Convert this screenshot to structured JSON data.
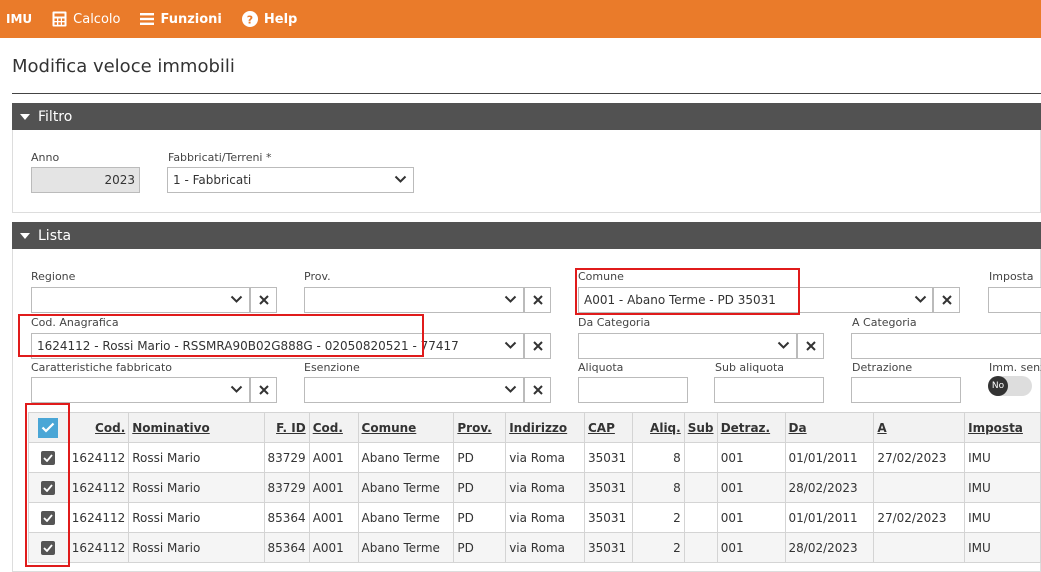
{
  "topbar": {
    "app": "IMU",
    "calcolo": "Calcolo",
    "funzioni": "Funzioni",
    "help": "Help"
  },
  "page_title": "Modifica veloce immobili",
  "filtro": {
    "title": "Filtro",
    "anno_label": "Anno",
    "anno_value": "2023",
    "fabbricati_label": "Fabbricati/Terreni *",
    "fabbricati_value": "1 - Fabbricati"
  },
  "lista": {
    "title": "Lista",
    "regione_label": "Regione",
    "regione_value": "",
    "prov_label": "Prov.",
    "prov_value": "",
    "comune_label": "Comune",
    "comune_value": "A001 - Abano Terme - PD 35031",
    "imposta_label": "Imposta",
    "cod_anagrafica_label": "Cod. Anagrafica",
    "cod_anagrafica_value": "1624112 - Rossi Mario - RSSMRA90B02G888G - 02050820521 - 77417",
    "da_categoria_label": "Da Categoria",
    "a_categoria_label": "A Categoria",
    "caratteristiche_label": "Caratteristiche fabbricato",
    "esenzione_label": "Esenzione",
    "aliquota_label": "Aliquota",
    "sub_aliquota_label": "Sub aliquota",
    "detrazione_label": "Detrazione",
    "imm_senza_label": "Imm. senz",
    "toggle_label": "No"
  },
  "table": {
    "headers": [
      "Cod.",
      "Nominativo",
      "F. ID",
      "Cod.",
      "Comune",
      "Prov.",
      "Indirizzo",
      "CAP",
      "Aliq.",
      "Sub",
      "Detraz.",
      "Da",
      "A",
      "Imposta"
    ],
    "rows": [
      [
        "1624112",
        "Rossi Mario",
        "83729",
        "A001",
        "Abano Terme",
        "PD",
        "via Roma",
        "35031",
        "8",
        "",
        "001",
        "01/01/2011",
        "27/02/2023",
        "IMU"
      ],
      [
        "1624112",
        "Rossi Mario",
        "83729",
        "A001",
        "Abano Terme",
        "PD",
        "via Roma",
        "35031",
        "8",
        "",
        "001",
        "28/02/2023",
        "",
        "IMU"
      ],
      [
        "1624112",
        "Rossi Mario",
        "85364",
        "A001",
        "Abano Terme",
        "PD",
        "via Roma",
        "35031",
        "2",
        "",
        "001",
        "01/01/2011",
        "27/02/2023",
        "IMU"
      ],
      [
        "1624112",
        "Rossi Mario",
        "85364",
        "A001",
        "Abano Terme",
        "PD",
        "via Roma",
        "35031",
        "2",
        "",
        "001",
        "28/02/2023",
        "",
        "IMU"
      ]
    ]
  },
  "colors": {
    "topbar": "#ea7b2a",
    "section_bar": "#525252",
    "highlight": "#e01b1b",
    "select_all": "#4aa6d6"
  },
  "icons": [
    "calculator-icon",
    "menu-icon",
    "help-icon",
    "chevron-down-icon",
    "close-icon",
    "check-icon"
  ]
}
